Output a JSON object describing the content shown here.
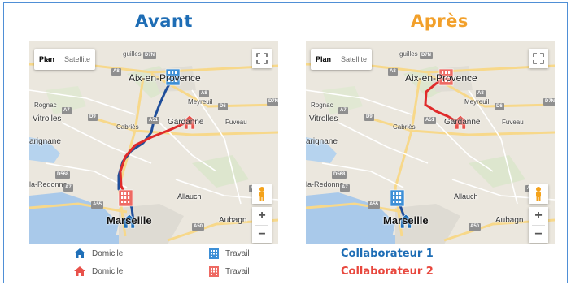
{
  "panels": [
    {
      "title": "Avant",
      "title_color": "#1e6db5",
      "route_blue_color": "#1f4e9a",
      "route_red_color": "#e02b2b"
    },
    {
      "title": "Après",
      "title_color": "#f2a02b",
      "route_blue_color": "#1f4e9a",
      "route_red_color": "#e02b2b"
    }
  ],
  "map": {
    "maptype_plan": "Plan",
    "maptype_satellite": "Satellite",
    "zoom_in": "+",
    "zoom_out": "−",
    "places": {
      "guilles": "guilles",
      "aix": "Aix-en-Provence",
      "meyreuil": "Meyreuil",
      "rognac": "Rognac",
      "vitrolles": "Vitrolles",
      "cabries": "Cabriès",
      "gardanne": "Gardanne",
      "fuveau": "Fuveau",
      "marignane": "arignane",
      "redonne": "la-Redonne",
      "allauch": "Allauch",
      "marseille": "Marseille",
      "aubagne": "Aubagn"
    },
    "roads": {
      "d7n": "D7N",
      "a8": "A8",
      "d6": "D6",
      "d9": "D9",
      "a51": "A51",
      "a7": "A7",
      "d568": "D568",
      "a55": "A55",
      "a50": "A50",
      "a52": "A52"
    }
  },
  "legend": {
    "home_blue": "Domicile",
    "work_blue": "Travail",
    "home_red": "Domicile",
    "work_red": "Travail",
    "collab1": "Collaborateur 1",
    "collab2": "Collaborateur 2",
    "collab1_color": "#1e6db5",
    "collab2_color": "#e8473d"
  }
}
